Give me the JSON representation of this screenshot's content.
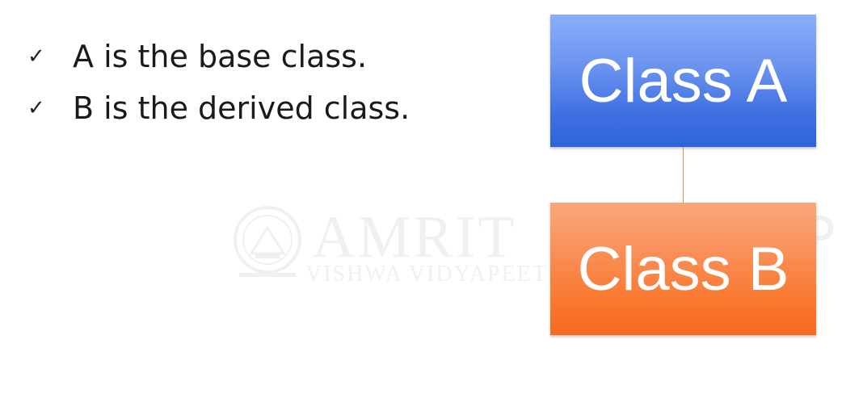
{
  "bullets": [
    {
      "icon": "check-icon",
      "text": "A is the base class."
    },
    {
      "icon": "check-icon",
      "text": "B is the derived class."
    }
  ],
  "diagram": {
    "class_a": {
      "label": "Class A",
      "color": "#4a7be6"
    },
    "class_b": {
      "label": "Class B",
      "color": "#f98a45"
    },
    "connector_color": "#f08a4b"
  },
  "watermark": {
    "title": "AMRIT",
    "subtitle": "VISHWA VIDYAPEET",
    "tail": "P"
  }
}
